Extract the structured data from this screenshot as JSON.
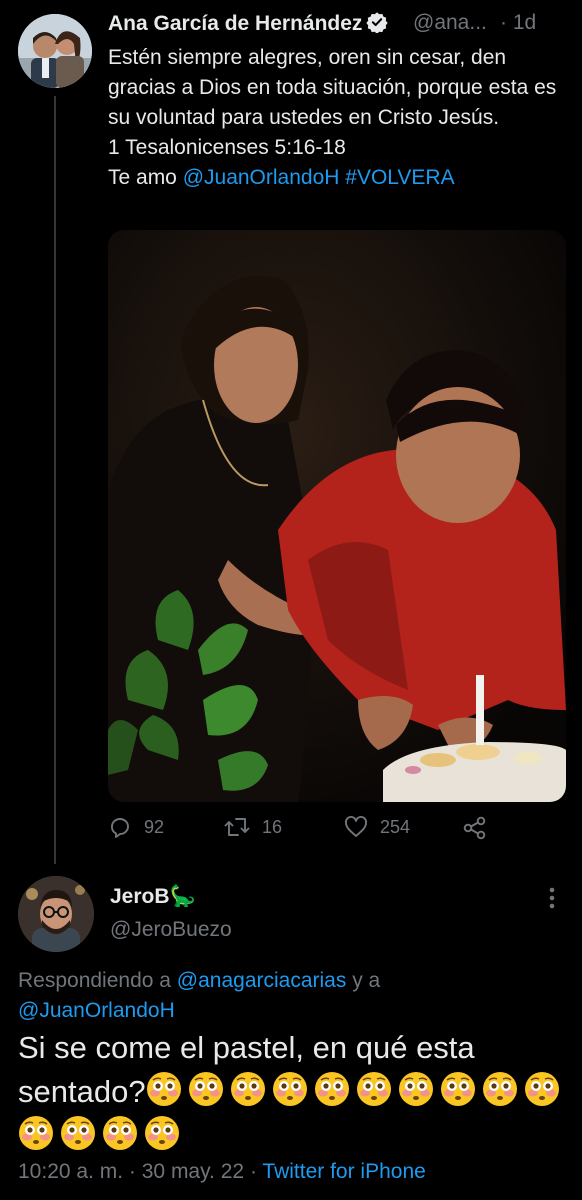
{
  "tweet": {
    "author_name": "Ana García de Hernández",
    "author_handle": "@ana...",
    "separator": "·",
    "age": "1d",
    "lines": [
      "Estén siempre alegres, oren sin cesar, den gracias a Dios en toda situación, porque esta es su voluntad para ustedes en Cristo Jesús.",
      "1 Tesalonicenses 5:16-18"
    ],
    "last_line_prefix": "Te amo ",
    "mention": "@JuanOrlandoH",
    "hashtag": "#VOLVERA",
    "replies": "92",
    "retweets": "16",
    "likes": "254"
  },
  "reply": {
    "author_name": "JeroB",
    "author_emoji": "🦕",
    "author_handle": "@JeroBuezo",
    "replying_prefix": "Respondiendo a ",
    "replying_user1": "@anagarciacarias",
    "replying_joiner": " y a",
    "replying_user2": "@JuanOrlandoH",
    "text": "Si se come el pastel, en qué esta sentado?",
    "emoji_count": 14,
    "emoji": "😳",
    "time": "10:20 a. m.",
    "dot": "·",
    "date": "30 may. 22",
    "source": "Twitter for iPhone"
  },
  "colors": {
    "background": "#000000",
    "text": "#e7e9ea",
    "secondary": "#71767b",
    "accent": "#1d9bf0"
  },
  "icons": [
    "verified-badge-icon",
    "reply-icon",
    "retweet-icon",
    "like-icon",
    "share-icon",
    "more-icon",
    "flushed-face-emoji"
  ]
}
